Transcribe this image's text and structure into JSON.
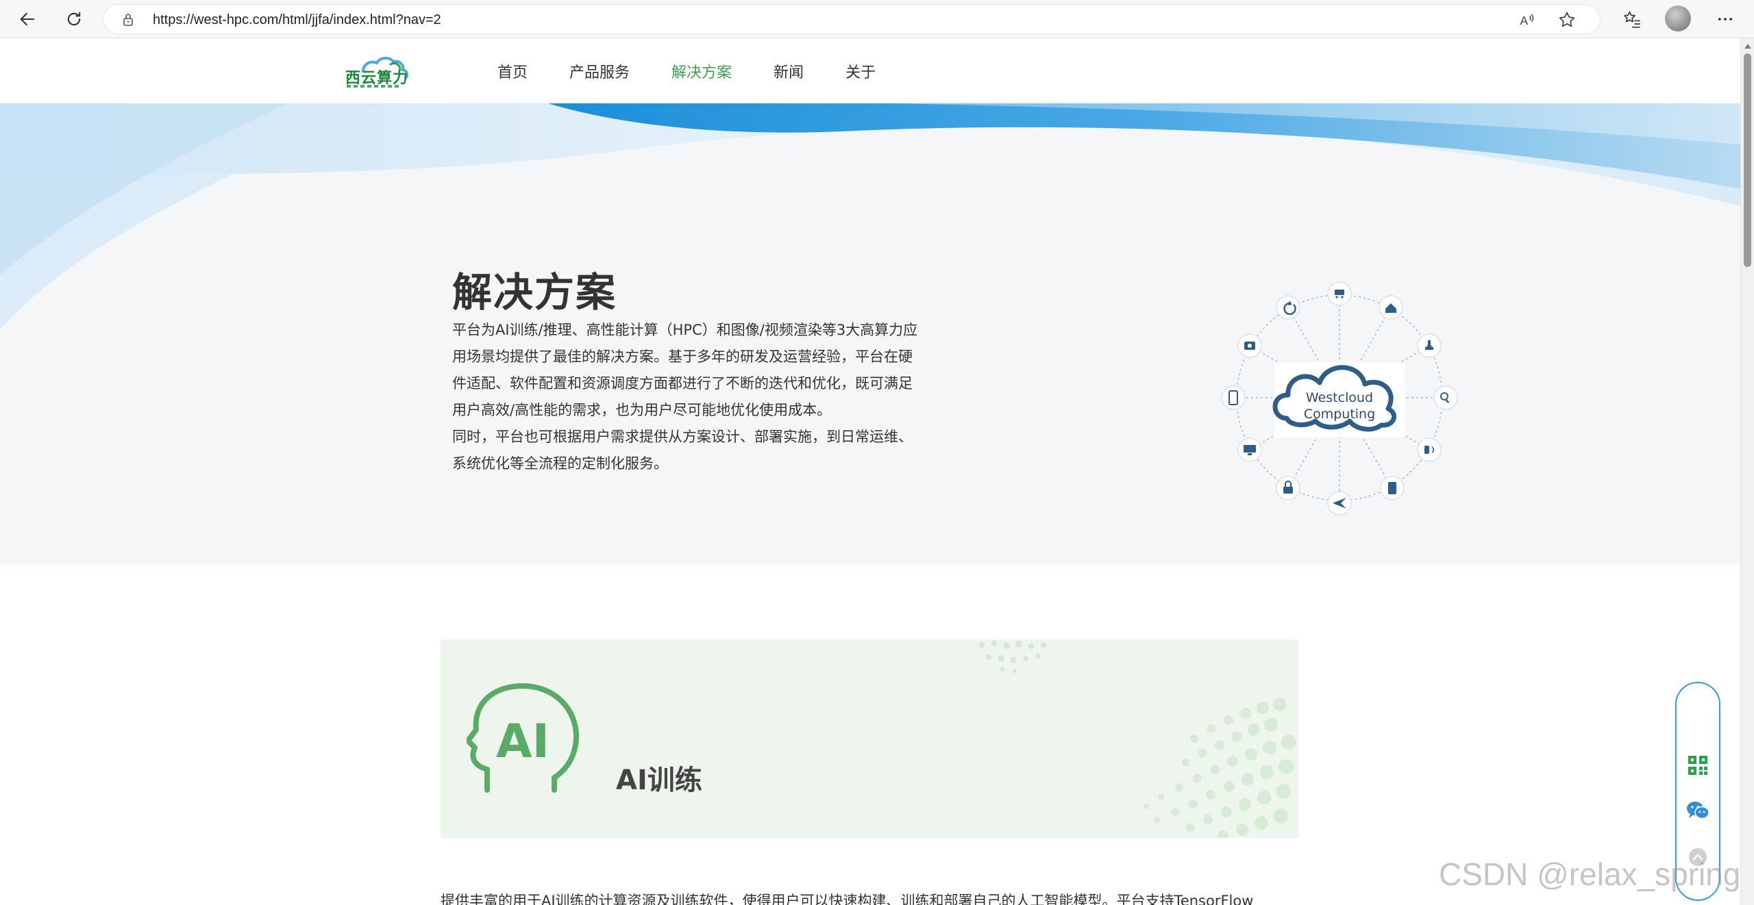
{
  "browser": {
    "url": "https://west-hpc.com/html/jjfa/index.html?nav=2",
    "icons": [
      "back-arrow-icon",
      "reload-icon",
      "lock-icon",
      "read-aloud-icon",
      "favorite-star-icon",
      "favorites-list-icon",
      "more-menu-icon"
    ]
  },
  "site": {
    "logo_text": "西云算力",
    "nav": [
      {
        "label": "首页",
        "active": false
      },
      {
        "label": "产品服务",
        "active": false
      },
      {
        "label": "解决方案",
        "active": true
      },
      {
        "label": "新闻",
        "active": false
      },
      {
        "label": "关于",
        "active": false
      }
    ],
    "accent_color": "#3fa14f"
  },
  "hero": {
    "title": "解决方案",
    "paragraph1": "平台为AI训练/推理、高性能计算（HPC）和图像/视频渲染等3大高算力应用场景均提供了最佳的解决方案。基于多年的研发及运营经验，平台在硬件适配、软件配置和资源调度方面都进行了不断的迭代和优化，既可满足用户高效/高性能的需求，也为用户尽可能地优化使用成本。",
    "paragraph2": "同时，平台也可根据用户需求提供从方案设计、部署实施，到日常运维、系统优化等全流程的定制化服务。",
    "diagram_line1": "Westcloud",
    "diagram_line2": "Computing"
  },
  "ai_section": {
    "icon_text": "AI",
    "title": "AI训练",
    "desc": "提供丰富的用于AI训练的计算资源及训练软件，使得用户可以快速构建、训练和部署自己的人工智能模型。平台支持TensorFlow"
  },
  "float_bar": {
    "icons": [
      "qrcode-icon",
      "wechat-icon",
      "back-to-top-icon"
    ]
  },
  "watermark": "CSDN @relax_spring"
}
